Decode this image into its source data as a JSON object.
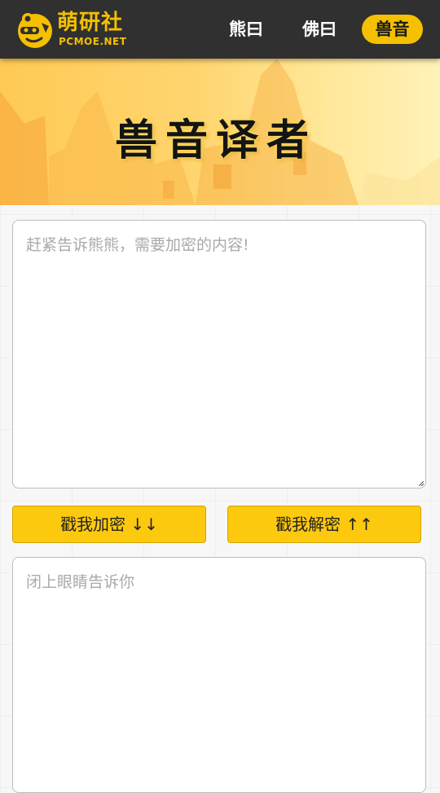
{
  "header": {
    "logo_title": "萌研社",
    "logo_sub": "PCMOE.NET",
    "nav": [
      {
        "label": "熊曰",
        "active": false
      },
      {
        "label": "佛曰",
        "active": false
      },
      {
        "label": "兽音",
        "active": true
      }
    ]
  },
  "banner": {
    "title": "兽音译者"
  },
  "input": {
    "placeholder": "赶紧告诉熊熊，需要加密的内容!"
  },
  "buttons": {
    "encrypt_label": "戳我加密 ↓↓",
    "decrypt_label": "戳我解密 ↑↑"
  },
  "output": {
    "placeholder": "闭上眼睛告诉你"
  },
  "colors": {
    "accent": "#fdc90f",
    "header_bg": "#303030",
    "logo": "#f5c000"
  },
  "icons": {
    "logo": "cartoon-face-logo-icon",
    "resize": "resize-grip-icon"
  }
}
